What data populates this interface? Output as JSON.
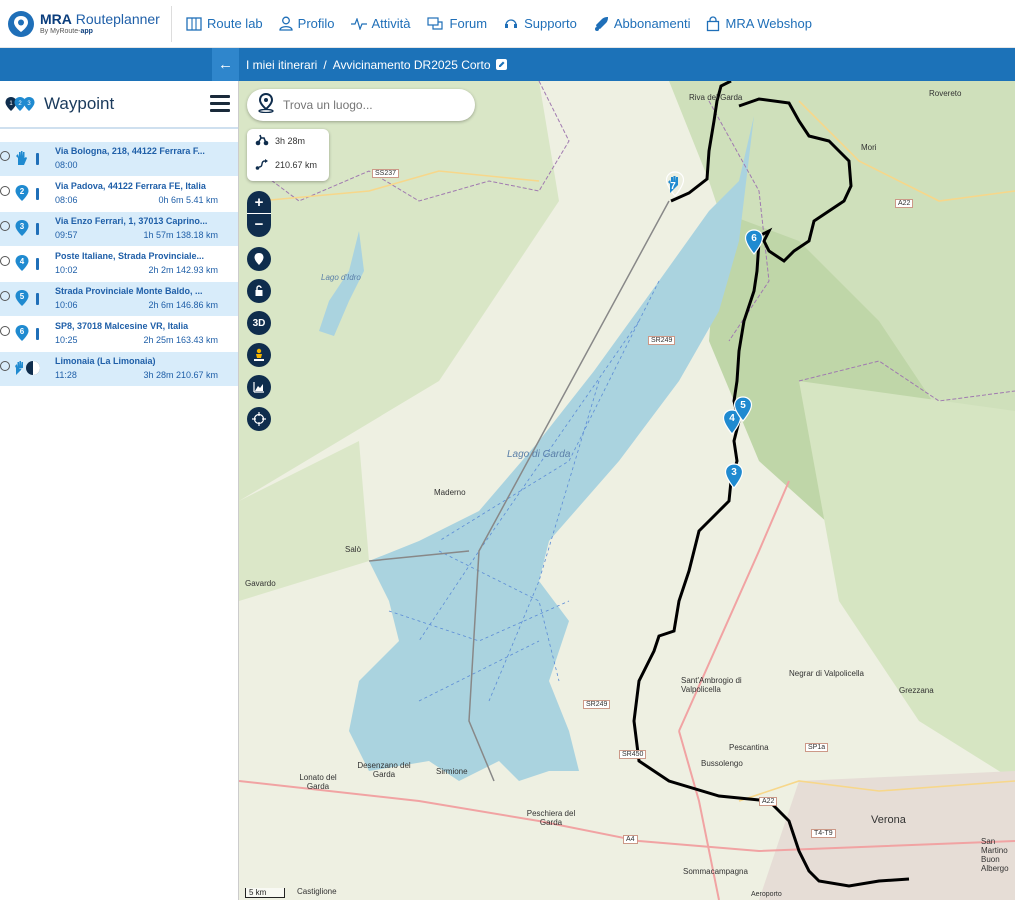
{
  "brand": {
    "name_bold": "MRA",
    "name_rest": "Routeplanner",
    "subtitle_by": "By MyRoute-",
    "subtitle_app": "app"
  },
  "nav": [
    {
      "label": "Route lab",
      "icon": "map-icon"
    },
    {
      "label": "Profilo",
      "icon": "user-icon"
    },
    {
      "label": "Attività",
      "icon": "activity-icon"
    },
    {
      "label": "Forum",
      "icon": "chat-icon"
    },
    {
      "label": "Supporto",
      "icon": "support-icon"
    },
    {
      "label": "Abbonamenti",
      "icon": "rocket-icon"
    },
    {
      "label": "MRA Webshop",
      "icon": "bag-icon"
    }
  ],
  "breadcrumb": {
    "parent": "I miei itinerari",
    "separator": "/",
    "current": "Avvicinamento DR2025 Corto"
  },
  "sidebar": {
    "title": "Waypoint",
    "waypoints": [
      {
        "name": "Via Bologna, 218, 44122 Ferrara F...",
        "time": "08:00",
        "duration": "",
        "pin": "start",
        "highlight": true
      },
      {
        "name": "Via Padova, 44122 Ferrara FE, Italia",
        "time": "08:06",
        "duration": "0h 6m  5.41 km",
        "pin": "2",
        "highlight": false
      },
      {
        "name": "Via Enzo Ferrari, 1, 37013 Caprino...",
        "time": "09:57",
        "duration": "1h 57m  138.18 km",
        "pin": "3",
        "highlight": true
      },
      {
        "name": "Poste Italiane, Strada Provinciale...",
        "time": "10:02",
        "duration": "2h 2m  142.93 km",
        "pin": "4",
        "highlight": false
      },
      {
        "name": "Strada Provinciale Monte Baldo, ...",
        "time": "10:06",
        "duration": "2h 6m  146.86 km",
        "pin": "5",
        "highlight": true
      },
      {
        "name": "SP8, 37018 Malcesine VR, Italia",
        "time": "10:25",
        "duration": "2h 25m  163.43 km",
        "pin": "6",
        "highlight": false
      },
      {
        "name": "Limonaia (La Limonaia)",
        "time": "11:28",
        "duration": "3h 28m  210.67 km",
        "pin": "end",
        "highlight": true
      }
    ]
  },
  "map": {
    "search_placeholder": "Trova un luogo...",
    "total_time": "3h 28m",
    "total_distance": "210.67 km",
    "scale": "5 km",
    "lake_name": "Lago di Garda",
    "places": [
      "Riva del Garda",
      "Rovereto",
      "Mori",
      "Lago d'Idro",
      "Maderno",
      "Salò",
      "Gavardo",
      "Sirmione",
      "Desenzano del Garda",
      "Lonato del Garda",
      "Peschiera del Garda",
      "Sant'Ambrogio di Valpolicella",
      "Negrar di Valpolicella",
      "Grezzana",
      "Pescantina",
      "Bussolengo",
      "Verona",
      "San Martino Buon Albergo",
      "Sommacampagna",
      "Castiglione",
      "Aeroporto"
    ],
    "roads": [
      "SS237",
      "A22",
      "SR249",
      "SR249",
      "SR450",
      "SP1a",
      "A22",
      "T4-T9",
      "A4"
    ],
    "marker_labels": [
      "3",
      "4",
      "5",
      "6",
      "7"
    ],
    "route_color": "#000000",
    "accent": "#1f8ad0"
  }
}
